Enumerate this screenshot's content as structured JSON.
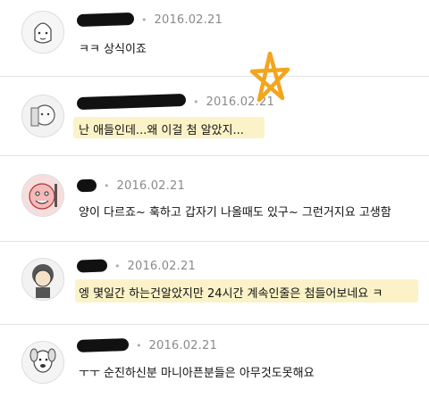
{
  "comments": [
    {
      "date": "2016.02.21",
      "text": "ㅋㅋ 상식이죠",
      "avatar": "avatar-icon"
    },
    {
      "date": "2016.02.21",
      "text": "난 애들인데...왜 이걸 첨 알았지...",
      "avatar": "avatar-icon"
    },
    {
      "date": "2016.02.21",
      "text": "양이 다르죠~ 훅하고 갑자기 나올때도 있구~ 그런거지요 고생함",
      "avatar": "avatar-icon"
    },
    {
      "date": "2016.02.21",
      "text": "엥 몇일간 하는건알았지만 24시간 계속인줄은 첨들어보네요 ㅋ",
      "avatar": "avatar-icon"
    },
    {
      "date": "2016.02.21",
      "text": "ㅜㅜ 순진하신분 마니아픈분들은 아무것도못해요",
      "avatar": "avatar-icon"
    }
  ],
  "colors": {
    "highlight": "#fbf2c7",
    "star": "#f3a51d",
    "redaction": "#111111"
  }
}
